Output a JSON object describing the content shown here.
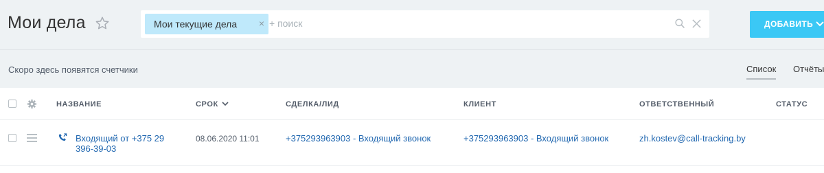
{
  "header": {
    "title": "Мои дела",
    "filter_chip": "Мои текущие дела",
    "search_placeholder": "+ поиск",
    "add_button": "ДОБАВИТЬ"
  },
  "toolbar": {
    "counters_note": "Скоро здесь появятся счетчики",
    "view_tabs": [
      "Список",
      "Отчёты"
    ],
    "active_view": "Список"
  },
  "grid": {
    "columns": [
      "НАЗВАНИЕ",
      "СРОК",
      "СДЕЛКА/ЛИД",
      "КЛИЕНТ",
      "ОТВЕТСТВЕННЫЙ",
      "СТАТУС"
    ],
    "sorted_column": "СРОК",
    "rows": [
      {
        "icon": "phone-icon",
        "name": "Входящий от +375 29 396-39-03",
        "deadline": "08.06.2020 11:01",
        "deal": "+375293963903 - Входящий звонок",
        "client": "+375293963903 - Входящий звонок",
        "responsible": "zh.kostev@call-tracking.by",
        "status": ""
      }
    ]
  },
  "colors": {
    "accent": "#3bc8f5",
    "chip": "#bfe9fb",
    "link": "#2067b0",
    "background": "#eef2f4"
  }
}
